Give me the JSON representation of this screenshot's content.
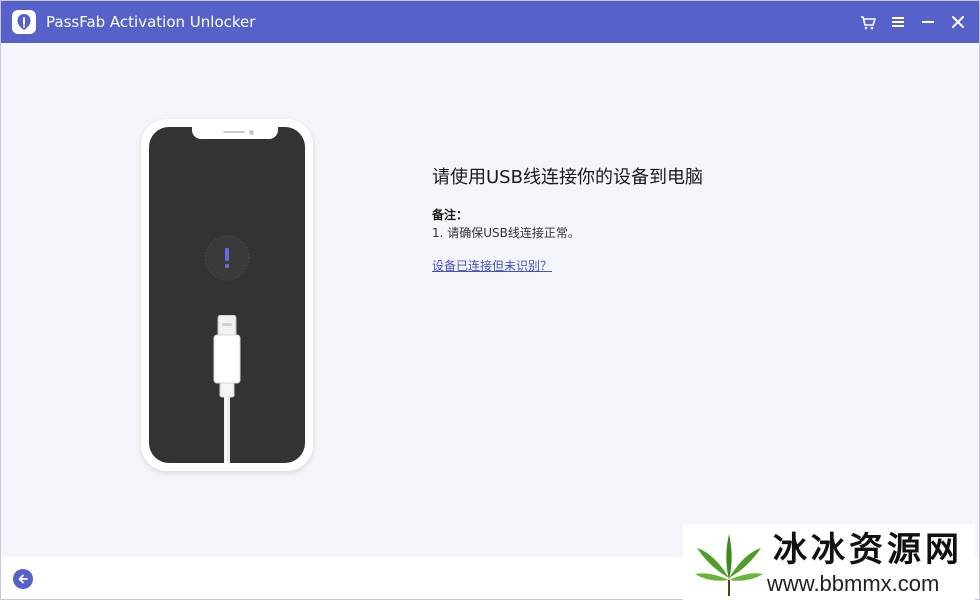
{
  "window": {
    "title": "PassFab Activation Unlocker",
    "accent_color": "#5661c9",
    "controls": [
      {
        "name": "cart-icon"
      },
      {
        "name": "menu-icon"
      },
      {
        "name": "minimize-icon"
      },
      {
        "name": "close-icon"
      }
    ]
  },
  "main": {
    "heading": "请使用USB线连接你的设备到电脑",
    "note_title": "备注：",
    "note_items": [
      "1. 请确保USB线连接正常。"
    ],
    "help_link": "设备已连接但未识别？",
    "link_color": "#4453c4"
  },
  "illustration": {
    "device": "phone-icon",
    "status": "alert-icon",
    "cable": "usb-cable-icon"
  },
  "footer": {
    "back": "back-arrow-icon"
  },
  "watermark": {
    "title": "冰冰资源网",
    "url": "www.bbmmx.com",
    "logo": "cannabis-leaf-logo"
  }
}
